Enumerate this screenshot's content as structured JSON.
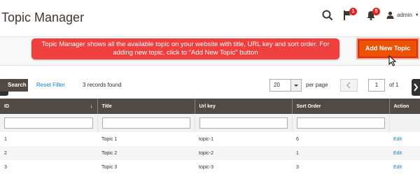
{
  "page": {
    "title": "Topic Manager"
  },
  "header": {
    "notifications_count": "1",
    "messages_count": "5",
    "user_name": "admin"
  },
  "tooltip": {
    "text": "Topic Manager shows all the available topic on your website with title, URL key and sort order. For adding new topic, click to \"Add New Topic\" button"
  },
  "actions": {
    "add_label": "Add New Topic"
  },
  "grid_controls": {
    "search_label": "Search",
    "reset_label": "Reset Filter",
    "records_found": "3 records found",
    "per_page_value": "20",
    "per_page_label": "per page",
    "current_page": "1",
    "total_pages_label": "of 1"
  },
  "table": {
    "columns": [
      "ID",
      "Title",
      "Url key",
      "Sort Order",
      "Action"
    ],
    "rows": [
      {
        "id": "1",
        "title": "Topic 1",
        "url_key": "topic-1",
        "sort_order": "6",
        "action": "Edit"
      },
      {
        "id": "2",
        "title": "Topic 2",
        "url_key": "topic-2",
        "sort_order": "1",
        "action": "Edit"
      },
      {
        "id": "3",
        "title": "Topic 3",
        "url_key": "topic-3",
        "sort_order": "3",
        "action": "Edit"
      }
    ]
  },
  "colors": {
    "accent": "#eb5202",
    "header_dark": "#514943",
    "link": "#1979c3",
    "tooltip_red": "#ef3f3f"
  }
}
